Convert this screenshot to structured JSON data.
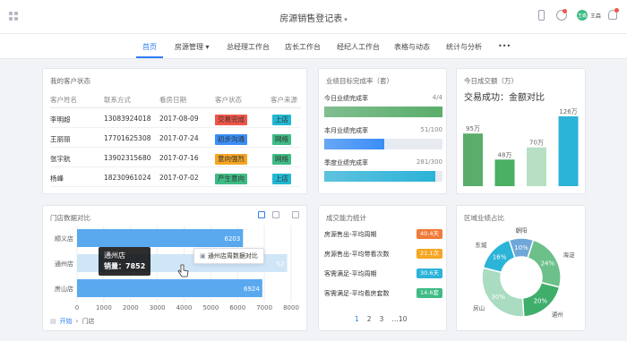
{
  "header": {
    "title": "房源销售登记表",
    "user": "王森"
  },
  "nav": {
    "items": [
      "首页",
      "房源管理",
      "总经理工作台",
      "店长工作台",
      "经纪人工作台",
      "表格与动态",
      "统计与分析",
      "•••"
    ]
  },
  "customers": {
    "title": "我的客户状态",
    "columns": [
      "客户姓名",
      "联系方式",
      "看房日期",
      "客户状态",
      "客户来源"
    ],
    "rows": [
      {
        "name": "李明超",
        "phone": "13083924018",
        "date": "2017-08-09",
        "status": "交易完成",
        "source": "上店"
      },
      {
        "name": "王丽丽",
        "phone": "17701625308",
        "date": "2017-07-24",
        "status": "初步沟通",
        "source": "网络"
      },
      {
        "name": "张宇航",
        "phone": "13902315680",
        "date": "2017-07-16",
        "status": "意向强烈",
        "source": "网络"
      },
      {
        "name": "杨峰",
        "phone": "18230961024",
        "date": "2017-07-02",
        "status": "产生意向",
        "source": "上店"
      }
    ],
    "status_colors": {
      "交易完成": "#f0564a",
      "初步沟通": "#3a8ef6",
      "意向强烈": "#f5a623",
      "产生意向": "#3fbb86"
    },
    "source_colors": {
      "上店": "#22b8d3",
      "网络": "#3fbb86"
    }
  },
  "targets": {
    "title": "业绩目标完成率（套）",
    "items": [
      {
        "label": "今日业绩完成率",
        "value": "4/4",
        "fraction": 1.0,
        "color": "#5aad6b"
      },
      {
        "label": "本月业绩完成率",
        "value": "51/100",
        "fraction": 0.51,
        "color": "#3a8ef6"
      },
      {
        "label": "季度业绩完成率",
        "value": "281/300",
        "fraction": 0.937,
        "color": "#2cb3d8"
      }
    ]
  },
  "today": {
    "title": "今日成交额（万）",
    "subtitle": "交易成功：金额对比",
    "chart_data": {
      "type": "bar",
      "labels": [
        "95万",
        "48万",
        "70万",
        "126万"
      ],
      "values": [
        95,
        48,
        70,
        126
      ],
      "colors": [
        "#5aad6b",
        "#4caf64",
        "#b7dfc4",
        "#2cb3d8"
      ]
    }
  },
  "stores": {
    "title": "门店数据对比",
    "chart_data": {
      "type": "bar",
      "categories": [
        "顺义店",
        "通州店",
        "房山店"
      ],
      "values": [
        6203,
        7852,
        6924
      ],
      "value_labels": [
        "6203",
        "52",
        "6924"
      ],
      "xticks": [
        "0",
        "1000",
        "2000",
        "3000",
        "4000",
        "5000",
        "6000",
        "7000",
        "8000"
      ],
      "xlim": [
        0,
        8000
      ]
    },
    "tooltip": {
      "store": "通州店",
      "sales": "销量：7852"
    },
    "popup": "通州店周数据对比",
    "breadcrumb": [
      "开始",
      "门店"
    ]
  },
  "capability": {
    "title": "成交能力统计",
    "rows": [
      {
        "label": "房源售出-平均周期",
        "value": "40.4天",
        "color": "#f07b3a"
      },
      {
        "label": "房源售出-平均带看次数",
        "value": "21.1次",
        "color": "#f5a623"
      },
      {
        "label": "客需满足-平均周期",
        "value": "30.6天",
        "color": "#2cb3d8"
      },
      {
        "label": "客需满足-平均看房套数",
        "value": "14.6套",
        "color": "#3fbb86"
      }
    ],
    "pager": [
      "1",
      "2",
      "3",
      "…10"
    ]
  },
  "region": {
    "title": "区域业绩占比",
    "chart_data": {
      "type": "pie",
      "slices": [
        {
          "name": "朝阳",
          "value": 10,
          "label": "10%",
          "color": "#6fa8d8"
        },
        {
          "name": "海淀",
          "value": 24,
          "label": "24%",
          "color": "#6cc08a"
        },
        {
          "name": "通州",
          "value": 20,
          "label": "20%",
          "color": "#3fae6b"
        },
        {
          "name": "房山",
          "value": 30,
          "label": "30%",
          "color": "#a9dcc0"
        },
        {
          "name": "东城",
          "value": 16,
          "label": "16%",
          "color": "#2cb3d8"
        }
      ]
    }
  }
}
